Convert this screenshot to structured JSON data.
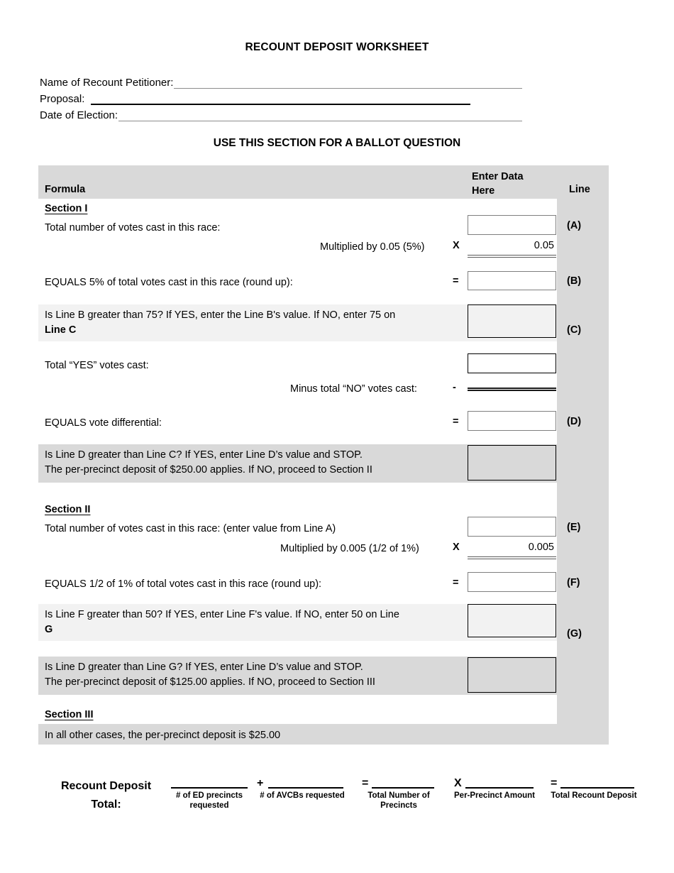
{
  "document": {
    "title": "RECOUNT DEPOSIT WORKSHEET",
    "subtitle": "USE THIS SECTION FOR A BALLOT QUESTION"
  },
  "header_fields": [
    {
      "label": "Name of Recount Petitioner:",
      "value": ""
    },
    {
      "label": "Proposal:",
      "value": ""
    },
    {
      "label": "Date of Election:",
      "value": ""
    }
  ],
  "table": {
    "columns": {
      "formula": "Formula",
      "enter_data_line1": "Enter Data",
      "enter_data_line2": "Here",
      "line": "Line"
    },
    "sections": {
      "one": "Section I",
      "two": "Section II",
      "three": "Section III"
    },
    "rows": {
      "a_text": "Total number of votes cast in this race:",
      "a_line": "(A)",
      "a_mult_text": "Multiplied by 0.05 (5%)",
      "a_mult_op": "X",
      "a_mult_value": "0.05",
      "b_text": "EQUALS 5% of total votes cast in this race (round up):",
      "b_op": "=",
      "b_line": "(B)",
      "c_text_1_pre": "Is ",
      "c_text_1_b1": "Line B greater than 75",
      "c_text_1_mid": "?  If ",
      "c_text_1_b2": "YES",
      "c_text_1_mid2": ", enter the ",
      "c_text_1_b3": "Line B's",
      "c_text_1_mid3": " value.  If ",
      "c_text_1_b4": "NO",
      "c_text_1_mid4": ", enter ",
      "c_text_1_b5": "75",
      "c_text_1_end": " on",
      "c_text_2": "Line C",
      "c_line": "(C)",
      "yes_text": "Total “YES” votes cast:",
      "no_text": "Minus total “NO” votes cast:",
      "no_op": "-",
      "d_text": "EQUALS vote differential:",
      "d_op": "=",
      "d_line": "(D)",
      "d_check_1_pre": "Is ",
      "d_check_1_b1": "Line D greater than Line C",
      "d_check_1_mid": "?  If ",
      "d_check_1_b2": "YES",
      "d_check_1_mid2": ", enter ",
      "d_check_1_b3": "Line D’s",
      "d_check_1_mid3": " value and ",
      "d_check_1_b4": "STOP",
      "d_check_1_end": ".",
      "d_check_2_pre": "The per-precinct deposit of ",
      "d_check_2_b1": "$250.00",
      "d_check_2_mid": " applies.  If ",
      "d_check_2_b2": "NO",
      "d_check_2_end": ", proceed to Section II",
      "e_text_pre": "Total number of votes cast in this race: (enter value from ",
      "e_text_b": "Line A",
      "e_text_end": ")",
      "e_line": "(E)",
      "e_mult_text": "Multiplied by 0.005 (1/2 of 1%)",
      "e_mult_op": "X",
      "e_mult_value": "0.005",
      "f_text": "EQUALS 1/2 of 1% of total votes cast in this race (round up):",
      "f_op": "=",
      "f_line": "(F)",
      "g_text_1_pre": "Is ",
      "g_text_1_b1": "Line F greater than 50",
      "g_text_1_mid": "?  If ",
      "g_text_1_b2": "YES",
      "g_text_1_mid2": ", enter ",
      "g_text_1_b3": "Line F's",
      "g_text_1_mid3": " value.  If ",
      "g_text_1_b4": "NO",
      "g_text_1_mid4": ", enter ",
      "g_text_1_b5": "50",
      "g_text_1_mid5": " on ",
      "g_text_1_b6": "Line",
      "g_text_2": "G",
      "g_line": "(G)",
      "g_check_1_pre": "Is ",
      "g_check_1_b1": "Line D greater than Line G",
      "g_check_1_mid": "?  If ",
      "g_check_1_b2": "YES",
      "g_check_1_mid2": ", enter ",
      "g_check_1_b3": "Line D’s",
      "g_check_1_mid3": " value and ",
      "g_check_1_b4": "STOP",
      "g_check_1_end": ".",
      "g_check_2_pre": "The per-precinct deposit of ",
      "g_check_2_b1": "$125.00",
      "g_check_2_mid": " applies.   If ",
      "g_check_2_b2": "NO",
      "g_check_2_mid2": ", proceed to ",
      "g_check_2_b3": "Section III",
      "s3_text_b": "In all other cases,",
      "s3_text_mid": " the per-precinct deposit is ",
      "s3_text_b2": "$25.00"
    }
  },
  "total": {
    "label_line1": "Recount Deposit",
    "label_line2": "Total:",
    "slots": [
      {
        "symbol": "",
        "caption": "# of ED precincts requested"
      },
      {
        "symbol": "+",
        "caption": "# of AVCBs requested"
      },
      {
        "symbol": "=",
        "caption": "Total Number of Precincts"
      },
      {
        "symbol": "X",
        "caption": "Per-Precinct Amount"
      },
      {
        "symbol": "=",
        "caption": "Total Recount Deposit"
      }
    ]
  }
}
